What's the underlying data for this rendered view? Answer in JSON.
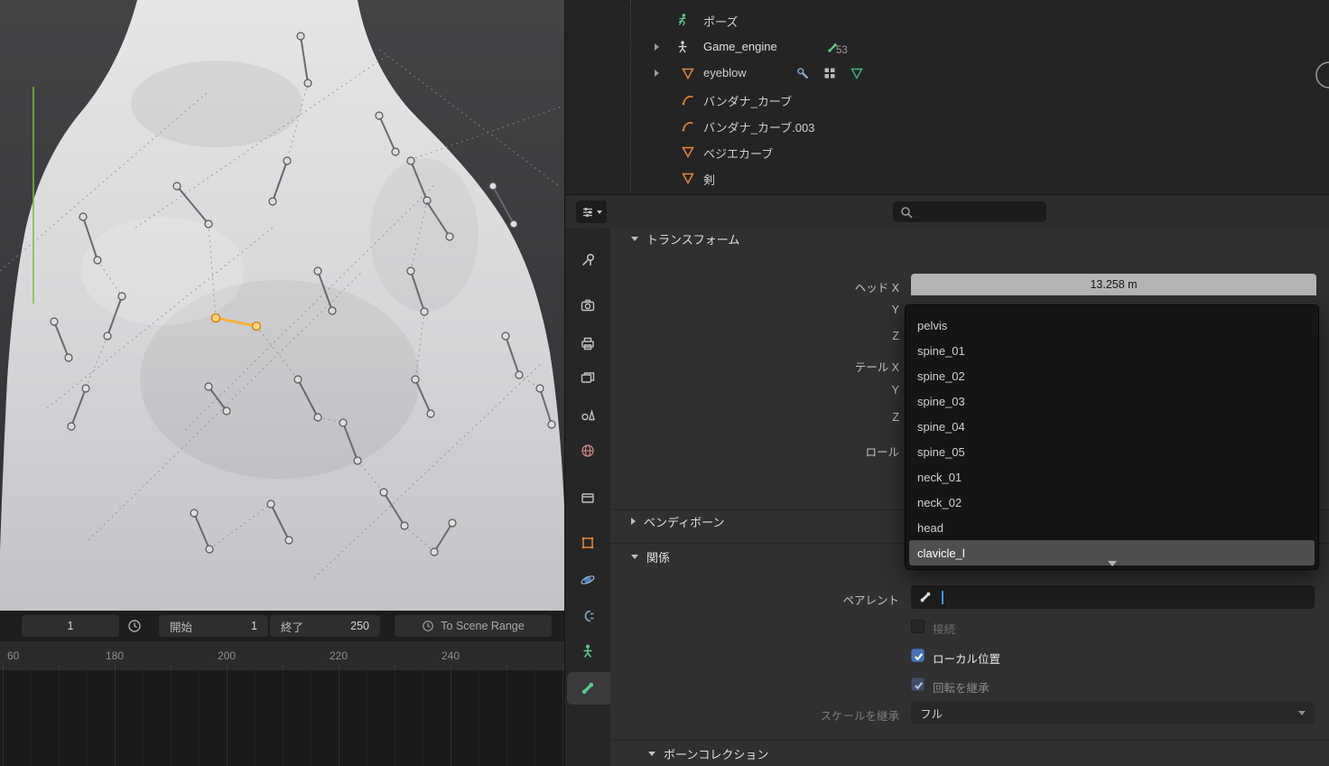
{
  "colors": {
    "accent_blue": "#4772b3",
    "selected_bone_orange": "#ffae2a",
    "icon_green": "#5fc78f",
    "icon_orange": "#e8873a"
  },
  "viewport": {
    "timeline": {
      "current_frame": "1",
      "start_label": "開始",
      "start_value": "1",
      "end_label": "終了",
      "end_value": "250",
      "to_scene_range_label": "To Scene Range",
      "ruler": [
        "60",
        "180",
        "200",
        "220",
        "240"
      ]
    }
  },
  "outliner": {
    "rows": [
      {
        "label": "ポーズ"
      },
      {
        "label": "Game_engine",
        "count": "53"
      },
      {
        "label": "eyeblow"
      },
      {
        "label": "バンダナ_カーブ"
      },
      {
        "label": "バンダナ_カーブ.003"
      },
      {
        "label": "ベジエカーブ"
      },
      {
        "label": "剣"
      }
    ]
  },
  "properties": {
    "panels": {
      "transform": "トランスフォーム",
      "bendy_bones": "ベンディボーン",
      "relations": "関係",
      "bone_collections": "ボーンコレクション"
    },
    "transform": {
      "head_label": "ヘッド X",
      "head_value": "13.258 m",
      "y_label": "Y",
      "z_label": "Z",
      "tail_label": "テール X",
      "tail_y_label": "Y",
      "tail_z_label": "Z",
      "roll_label": "ロール"
    },
    "relations": {
      "parent_label": "ペアレント",
      "connected_label": "接続",
      "local_location_label": "ローカル位置",
      "inherit_rotation_label": "回転を継承",
      "inherit_scale_label": "スケールを継承",
      "inherit_scale_value": "フル"
    }
  },
  "bone_dropdown": {
    "items": [
      "pelvis",
      "spine_01",
      "spine_02",
      "spine_03",
      "spine_04",
      "spine_05",
      "neck_01",
      "neck_02",
      "head",
      "clavicle_l"
    ],
    "highlighted": "clavicle_l"
  }
}
